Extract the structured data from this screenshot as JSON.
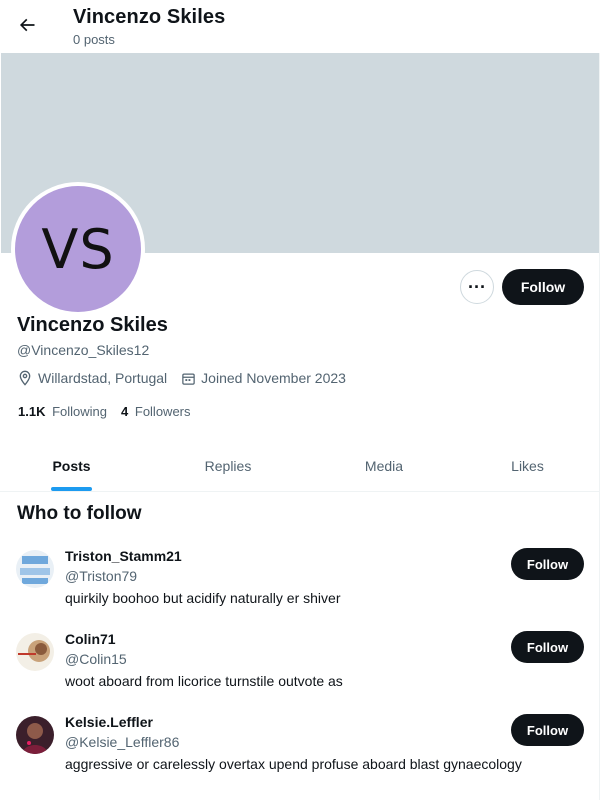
{
  "header": {
    "title": "Vincenzo Skiles",
    "subtitle": "0 posts"
  },
  "profile": {
    "initials": "VS",
    "avatar_color": "#b39ddb",
    "banner_color": "#cfd9de",
    "name": "Vincenzo Skiles",
    "handle": "@Vincenzo_Skiles12",
    "location": "Willardstad, Portugal",
    "joined": "Joined November 2023",
    "following_count": "1.1K",
    "following_label": "Following",
    "followers_count": "4",
    "followers_label": "Followers",
    "more_label": "···",
    "follow_label": "Follow"
  },
  "tabs": [
    {
      "label": "Posts",
      "active": true
    },
    {
      "label": "Replies",
      "active": false
    },
    {
      "label": "Media",
      "active": false
    },
    {
      "label": "Likes",
      "active": false
    }
  ],
  "who_to_follow": {
    "title": "Who to follow",
    "items": [
      {
        "name": "Triston_Stamm21",
        "handle": "@Triston79",
        "bio": "quirkily boohoo but acidify naturally er shiver",
        "follow_label": "Follow"
      },
      {
        "name": "Colin71",
        "handle": "@Colin15",
        "bio": "woot aboard from licorice turnstile outvote as",
        "follow_label": "Follow"
      },
      {
        "name": "Kelsie.Leffler",
        "handle": "@Kelsie_Leffler86",
        "bio": "aggressive or carelessly overtax upend profuse aboard blast gynaecology",
        "follow_label": "Follow"
      }
    ]
  },
  "colors": {
    "accent": "#1d9bf0",
    "button_dark": "#0f1419",
    "secondary_text": "#536471"
  }
}
